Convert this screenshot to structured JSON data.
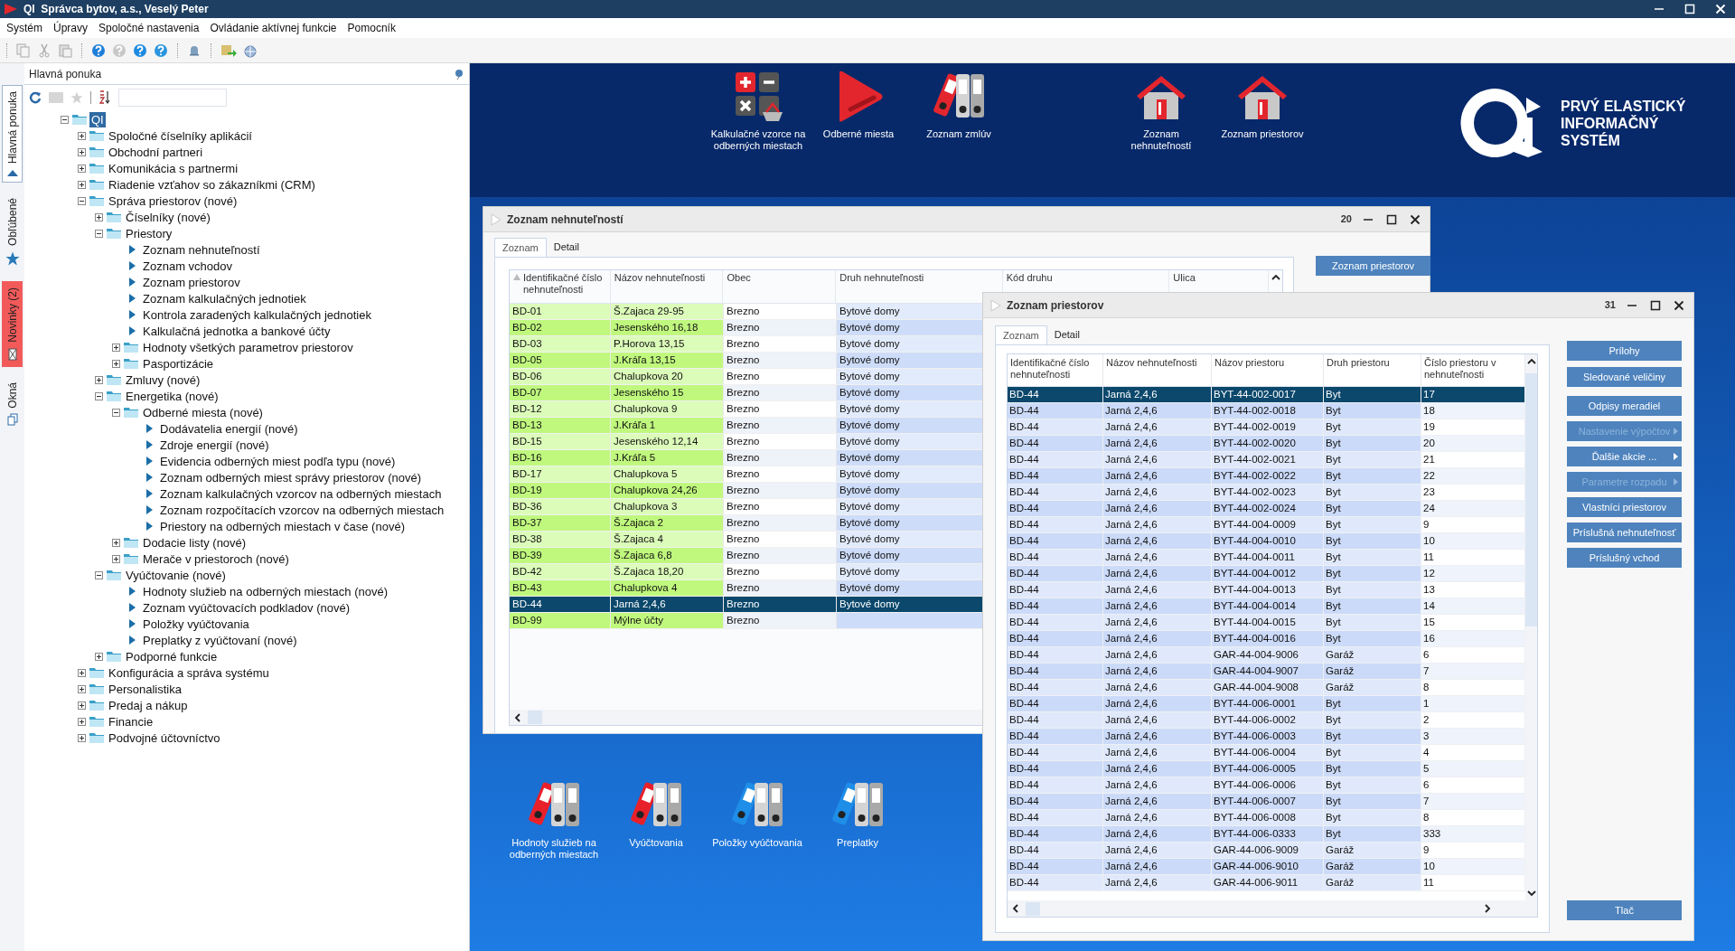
{
  "window": {
    "title": "QI  Správca bytov, a.s., Veselý Peter"
  },
  "menu": [
    "Systém",
    "Úpravy",
    "Spoločné nastavenia",
    "Ovládanie aktívnej funkcie",
    "Pomocník"
  ],
  "side_tabs": [
    {
      "label": "Hlavná ponuka",
      "selected": true,
      "alert": false
    },
    {
      "label": "Obľúbené",
      "selected": false,
      "alert": false
    },
    {
      "label": "Novinky (2)",
      "selected": false,
      "alert": true
    },
    {
      "label": "Okná",
      "selected": false,
      "alert": false
    }
  ],
  "panel": {
    "title": "Hlavná ponuka"
  },
  "tree": [
    {
      "label": "QI",
      "kind": "folder",
      "expanded": true,
      "selected": true,
      "children": [
        {
          "label": "Spoločné číselníky aplikácií",
          "kind": "folder",
          "expanded": false,
          "selected": false
        },
        {
          "label": "Obchodní partneri",
          "kind": "folder",
          "expanded": false,
          "selected": false
        },
        {
          "label": "Komunikácia s partnermi",
          "kind": "folder",
          "expanded": false,
          "selected": false
        },
        {
          "label": "Riadenie vzťahov so zákazníkmi (CRM)",
          "kind": "folder",
          "expanded": false,
          "selected": false
        },
        {
          "label": "Správa priestorov (nové)",
          "kind": "folder",
          "expanded": true,
          "selected": false,
          "children": [
            {
              "label": "Číselníky (nové)",
              "kind": "folder",
              "expanded": false,
              "selected": false
            },
            {
              "label": "Priestory",
              "kind": "folder",
              "expanded": true,
              "selected": false,
              "children": [
                {
                  "label": "Zoznam nehnuteľností",
                  "kind": "leaf",
                  "selected": false
                },
                {
                  "label": "Zoznam vchodov",
                  "kind": "leaf",
                  "selected": false
                },
                {
                  "label": "Zoznam priestorov",
                  "kind": "leaf",
                  "selected": false
                },
                {
                  "label": "Zoznam kalkulačných jednotiek",
                  "kind": "leaf",
                  "selected": false
                },
                {
                  "label": "Kontrola zaradených kalkulačných jednotiek",
                  "kind": "leaf",
                  "selected": false
                },
                {
                  "label": "Kalkulačná jednotka a bankové účty",
                  "kind": "leaf",
                  "selected": false
                },
                {
                  "label": "Hodnoty všetkých parametrov priestorov",
                  "kind": "folder",
                  "expanded": false,
                  "selected": false
                },
                {
                  "label": "Pasportizácie",
                  "kind": "folder",
                  "expanded": false,
                  "selected": false
                }
              ]
            },
            {
              "label": "Zmluvy (nové)",
              "kind": "folder",
              "expanded": false,
              "selected": false
            },
            {
              "label": "Energetika (nové)",
              "kind": "folder",
              "expanded": true,
              "selected": false,
              "children": [
                {
                  "label": "Odberné miesta (nové)",
                  "kind": "folder",
                  "expanded": true,
                  "selected": false,
                  "children": [
                    {
                      "label": "Dodávatelia energií (nové)",
                      "kind": "leaf",
                      "selected": false
                    },
                    {
                      "label": "Zdroje energií (nové)",
                      "kind": "leaf",
                      "selected": false
                    },
                    {
                      "label": "Evidencia odberných miest podľa typu (nové)",
                      "kind": "leaf",
                      "selected": false
                    },
                    {
                      "label": "Zoznam odberných miest správy priestorov (nové)",
                      "kind": "leaf",
                      "selected": false
                    },
                    {
                      "label": "Zoznam kalkulačných vzorcov na odberných miestach",
                      "kind": "leaf",
                      "selected": false
                    },
                    {
                      "label": "Zoznam rozpočítacích vzorcov na odberných miestach",
                      "kind": "leaf",
                      "selected": false
                    },
                    {
                      "label": "Priestory na odberných miestach v čase (nové)",
                      "kind": "leaf",
                      "selected": false
                    }
                  ]
                },
                {
                  "label": "Dodacie listy (nové)",
                  "kind": "folder",
                  "expanded": false,
                  "selected": false
                },
                {
                  "label": "Merače v priestoroch (nové)",
                  "kind": "folder",
                  "expanded": false,
                  "selected": false
                }
              ]
            },
            {
              "label": "Vyúčtovanie (nové)",
              "kind": "folder",
              "expanded": true,
              "selected": false,
              "children": [
                {
                  "label": "Hodnoty služieb na odberných miestach (nové)",
                  "kind": "leaf",
                  "selected": false
                },
                {
                  "label": "Zoznam vyúčtovacích podkladov (nové)",
                  "kind": "leaf",
                  "selected": false
                },
                {
                  "label": "Položky vyúčtovania",
                  "kind": "leaf",
                  "selected": false
                },
                {
                  "label": "Preplatky z vyúčtovaní (nové)",
                  "kind": "leaf",
                  "selected": false
                }
              ]
            },
            {
              "label": "Podporné funkcie",
              "kind": "folder",
              "expanded": false,
              "selected": false
            }
          ]
        },
        {
          "label": "Konfigurácia a správa systému",
          "kind": "folder",
          "expanded": false,
          "selected": false
        },
        {
          "label": "Personalistika",
          "kind": "folder",
          "expanded": false,
          "selected": false
        },
        {
          "label": "Predaj a nákup",
          "kind": "folder",
          "expanded": false,
          "selected": false
        },
        {
          "label": "Financie",
          "kind": "folder",
          "expanded": false,
          "selected": false
        },
        {
          "label": "Podvojné účtovníctvo",
          "kind": "folder",
          "expanded": false,
          "selected": false
        }
      ]
    }
  ],
  "top_shortcuts": [
    {
      "label": "Kalkulačné vzorce na odberných miestach",
      "kind": "calculator"
    },
    {
      "label": "Odberné miesta",
      "kind": "play"
    },
    {
      "label": "Zoznam zmlúv",
      "kind": "binders"
    },
    {
      "label": "Zoznam nehnuteľností",
      "kind": "house"
    },
    {
      "label": "Zoznam priestorov",
      "kind": "house"
    }
  ],
  "logo": {
    "lines": [
      "PRVÝ ELASTICKÝ",
      "INFORMAČNÝ",
      "SYSTÉM"
    ]
  },
  "bottom_shortcuts": [
    {
      "label": "Hodnoty služieb na odberných miestach",
      "color": "#e8202a"
    },
    {
      "label": "Vyúčtovania",
      "color": "#e8202a"
    },
    {
      "label": "Položky vyúčtovania",
      "color": "#1e8ee8"
    },
    {
      "label": "Preplatky",
      "color": "#1e8ee8"
    }
  ],
  "property_window": {
    "title": "Zoznam nehnuteľností",
    "count": "20",
    "tabs": [
      {
        "label": "Zoznam",
        "selected": true
      },
      {
        "label": "Detail",
        "selected": false
      }
    ],
    "columns": [
      "Identifikačné číslo nehnuteľnosti",
      "Názov nehnuteľnosti",
      "Obec",
      "Druh nehnuteľnosti",
      "Kód druhu",
      "Ulica"
    ],
    "rows": [
      {
        "id": "BD-01",
        "name": "Š.Zajaca 29-95",
        "town": "Brezno",
        "type": "Bytové domy",
        "selected": false
      },
      {
        "id": "BD-02",
        "name": "Jesenského 16,18",
        "town": "Brezno",
        "type": "Bytové domy",
        "selected": false
      },
      {
        "id": "BD-03",
        "name": "P.Horova 13,15",
        "town": "Brezno",
        "type": "Bytové domy",
        "selected": false
      },
      {
        "id": "BD-05",
        "name": "J.Kráľa 13,15",
        "town": "Brezno",
        "type": "Bytové domy",
        "selected": false
      },
      {
        "id": "BD-06",
        "name": "Chalupkova 20",
        "town": "Brezno",
        "type": "Bytové domy",
        "selected": false
      },
      {
        "id": "BD-07",
        "name": "Jesenského 15",
        "town": "Brezno",
        "type": "Bytové domy",
        "selected": false
      },
      {
        "id": "BD-12",
        "name": "Chalupkova 9",
        "town": "Brezno",
        "type": "Bytové domy",
        "selected": false
      },
      {
        "id": "BD-13",
        "name": "J.Kráľa 1",
        "town": "Brezno",
        "type": "Bytové domy",
        "selected": false
      },
      {
        "id": "BD-15",
        "name": "Jesenského 12,14",
        "town": "Brezno",
        "type": "Bytové domy",
        "selected": false
      },
      {
        "id": "BD-16",
        "name": "J.Kráľa 5",
        "town": "Brezno",
        "type": "Bytové domy",
        "selected": false
      },
      {
        "id": "BD-17",
        "name": "Chalupkova 5",
        "town": "Brezno",
        "type": "Bytové domy",
        "selected": false
      },
      {
        "id": "BD-19",
        "name": "Chalupkova 24,26",
        "town": "Brezno",
        "type": "Bytové domy",
        "selected": false
      },
      {
        "id": "BD-36",
        "name": "Chalupkova 3",
        "town": "Brezno",
        "type": "Bytové domy",
        "selected": false
      },
      {
        "id": "BD-37",
        "name": "Š.Zajaca 2",
        "town": "Brezno",
        "type": "Bytové domy",
        "selected": false
      },
      {
        "id": "BD-38",
        "name": "Š.Zajaca 4",
        "town": "Brezno",
        "type": "Bytové domy",
        "selected": false
      },
      {
        "id": "BD-39",
        "name": "Š.Zajaca 6,8",
        "town": "Brezno",
        "type": "Bytové domy",
        "selected": false
      },
      {
        "id": "BD-42",
        "name": "Š.Zajaca 18,20",
        "town": "Brezno",
        "type": "Bytové domy",
        "selected": false
      },
      {
        "id": "BD-43",
        "name": "Chalupkova 4",
        "town": "Brezno",
        "type": "Bytové domy",
        "selected": false
      },
      {
        "id": "BD-44",
        "name": "Jarná 2,4,6",
        "town": "Brezno",
        "type": "Bytové domy",
        "selected": true
      },
      {
        "id": "BD-99",
        "name": "Mýlne účty",
        "town": "Brezno",
        "selected": false
      }
    ],
    "buttons": [
      {
        "label": "Zoznam priestorov",
        "disabled": false,
        "submenu": false
      }
    ]
  },
  "space_window": {
    "title": "Zoznam priestorov",
    "count": "31",
    "tabs": [
      {
        "label": "Zoznam",
        "selected": true
      },
      {
        "label": "Detail",
        "selected": false
      }
    ],
    "columns": [
      "Identifikačné číslo nehnuteľnosti",
      "Názov nehnuteľnosti",
      "Názov priestoru",
      "Druh priestoru",
      "Číslo priestoru v nehnuteľnosti"
    ],
    "rows": [
      {
        "cells": [
          "BD-44",
          "Jarná 2,4,6",
          "BYT-44-002-0017",
          "Byt",
          "17"
        ],
        "selected": true
      },
      {
        "cells": [
          "BD-44",
          "Jarná 2,4,6",
          "BYT-44-002-0018",
          "Byt",
          "18"
        ],
        "selected": false
      },
      {
        "cells": [
          "BD-44",
          "Jarná 2,4,6",
          "BYT-44-002-0019",
          "Byt",
          "19"
        ],
        "selected": false
      },
      {
        "cells": [
          "BD-44",
          "Jarná 2,4,6",
          "BYT-44-002-0020",
          "Byt",
          "20"
        ],
        "selected": false
      },
      {
        "cells": [
          "BD-44",
          "Jarná 2,4,6",
          "BYT-44-002-0021",
          "Byt",
          "21"
        ],
        "selected": false
      },
      {
        "cells": [
          "BD-44",
          "Jarná 2,4,6",
          "BYT-44-002-0022",
          "Byt",
          "22"
        ],
        "selected": false
      },
      {
        "cells": [
          "BD-44",
          "Jarná 2,4,6",
          "BYT-44-002-0023",
          "Byt",
          "23"
        ],
        "selected": false
      },
      {
        "cells": [
          "BD-44",
          "Jarná 2,4,6",
          "BYT-44-002-0024",
          "Byt",
          "24"
        ],
        "selected": false
      },
      {
        "cells": [
          "BD-44",
          "Jarná 2,4,6",
          "BYT-44-004-0009",
          "Byt",
          "9"
        ],
        "selected": false
      },
      {
        "cells": [
          "BD-44",
          "Jarná 2,4,6",
          "BYT-44-004-0010",
          "Byt",
          "10"
        ],
        "selected": false
      },
      {
        "cells": [
          "BD-44",
          "Jarná 2,4,6",
          "BYT-44-004-0011",
          "Byt",
          "11"
        ],
        "selected": false
      },
      {
        "cells": [
          "BD-44",
          "Jarná 2,4,6",
          "BYT-44-004-0012",
          "Byt",
          "12"
        ],
        "selected": false
      },
      {
        "cells": [
          "BD-44",
          "Jarná 2,4,6",
          "BYT-44-004-0013",
          "Byt",
          "13"
        ],
        "selected": false
      },
      {
        "cells": [
          "BD-44",
          "Jarná 2,4,6",
          "BYT-44-004-0014",
          "Byt",
          "14"
        ],
        "selected": false
      },
      {
        "cells": [
          "BD-44",
          "Jarná 2,4,6",
          "BYT-44-004-0015",
          "Byt",
          "15"
        ],
        "selected": false
      },
      {
        "cells": [
          "BD-44",
          "Jarná 2,4,6",
          "BYT-44-004-0016",
          "Byt",
          "16"
        ],
        "selected": false
      },
      {
        "cells": [
          "BD-44",
          "Jarná 2,4,6",
          "GAR-44-004-9006",
          "Garáž",
          "6"
        ],
        "selected": false
      },
      {
        "cells": [
          "BD-44",
          "Jarná 2,4,6",
          "GAR-44-004-9007",
          "Garáž",
          "7"
        ],
        "selected": false
      },
      {
        "cells": [
          "BD-44",
          "Jarná 2,4,6",
          "GAR-44-004-9008",
          "Garáž",
          "8"
        ],
        "selected": false
      },
      {
        "cells": [
          "BD-44",
          "Jarná 2,4,6",
          "BYT-44-006-0001",
          "Byt",
          "1"
        ],
        "selected": false
      },
      {
        "cells": [
          "BD-44",
          "Jarná 2,4,6",
          "BYT-44-006-0002",
          "Byt",
          "2"
        ],
        "selected": false
      },
      {
        "cells": [
          "BD-44",
          "Jarná 2,4,6",
          "BYT-44-006-0003",
          "Byt",
          "3"
        ],
        "selected": false
      },
      {
        "cells": [
          "BD-44",
          "Jarná 2,4,6",
          "BYT-44-006-0004",
          "Byt",
          "4"
        ],
        "selected": false
      },
      {
        "cells": [
          "BD-44",
          "Jarná 2,4,6",
          "BYT-44-006-0005",
          "Byt",
          "5"
        ],
        "selected": false
      },
      {
        "cells": [
          "BD-44",
          "Jarná 2,4,6",
          "BYT-44-006-0006",
          "Byt",
          "6"
        ],
        "selected": false
      },
      {
        "cells": [
          "BD-44",
          "Jarná 2,4,6",
          "BYT-44-006-0007",
          "Byt",
          "7"
        ],
        "selected": false
      },
      {
        "cells": [
          "BD-44",
          "Jarná 2,4,6",
          "BYT-44-006-0008",
          "Byt",
          "8"
        ],
        "selected": false
      },
      {
        "cells": [
          "BD-44",
          "Jarná 2,4,6",
          "BYT-44-006-0333",
          "Byt",
          "333"
        ],
        "selected": false
      },
      {
        "cells": [
          "BD-44",
          "Jarná 2,4,6",
          "GAR-44-006-9009",
          "Garáž",
          "9"
        ],
        "selected": false
      },
      {
        "cells": [
          "BD-44",
          "Jarná 2,4,6",
          "GAR-44-006-9010",
          "Garáž",
          "10"
        ],
        "selected": false
      },
      {
        "cells": [
          "BD-44",
          "Jarná 2,4,6",
          "GAR-44-006-9011",
          "Garáž",
          "11"
        ],
        "selected": false
      }
    ],
    "buttons": [
      {
        "label": "Prílohy",
        "disabled": false,
        "submenu": false
      },
      {
        "label": "Sledované veličiny",
        "disabled": false,
        "submenu": false
      },
      {
        "label": "Odpisy meradiel",
        "disabled": false,
        "submenu": false
      },
      {
        "label": "Nastavenie výpočtov",
        "disabled": true,
        "submenu": true
      },
      {
        "label": "Ďalšie akcie ...",
        "disabled": false,
        "submenu": true
      },
      {
        "label": "Parametre rozpadu",
        "disabled": true,
        "submenu": true
      },
      {
        "label": "Vlastníci priestorov",
        "disabled": false,
        "submenu": false
      },
      {
        "label": "Príslušná nehnuteľnosť",
        "disabled": false,
        "submenu": false
      },
      {
        "label": "Príslušný vchod",
        "disabled": false,
        "submenu": false
      }
    ],
    "print_button": {
      "label": "Tlač",
      "disabled": false
    }
  }
}
